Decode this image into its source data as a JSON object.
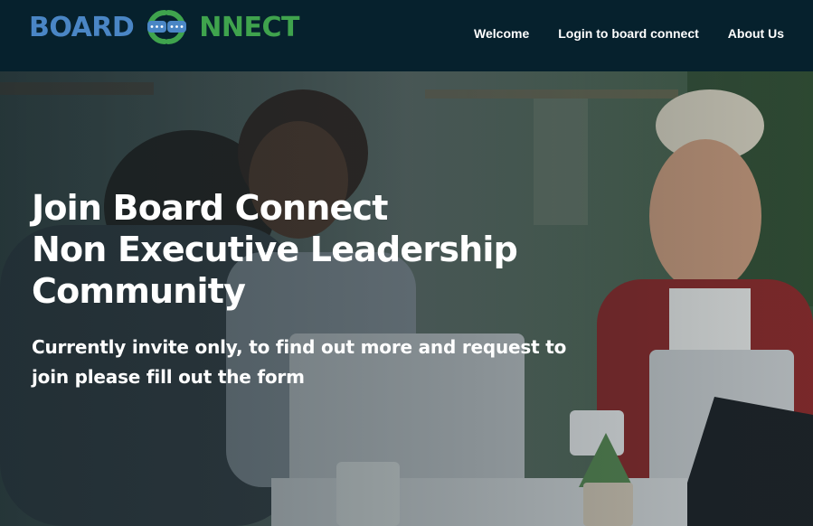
{
  "brand": {
    "logo_part1": "BOARD",
    "logo_part2": "NNECT",
    "colors": {
      "blue": "#4a86c5",
      "green": "#3fa34d",
      "header_bg": "#06212d"
    }
  },
  "nav": {
    "items": [
      {
        "label": "Welcome"
      },
      {
        "label": "Login to board connect"
      },
      {
        "label": "About Us"
      }
    ]
  },
  "hero": {
    "title_lines": [
      "Join Board Connect",
      "Non Executive Leadership",
      "Community"
    ],
    "subtitle": "Currently invite only, to find out more and request to join please fill out the form"
  }
}
